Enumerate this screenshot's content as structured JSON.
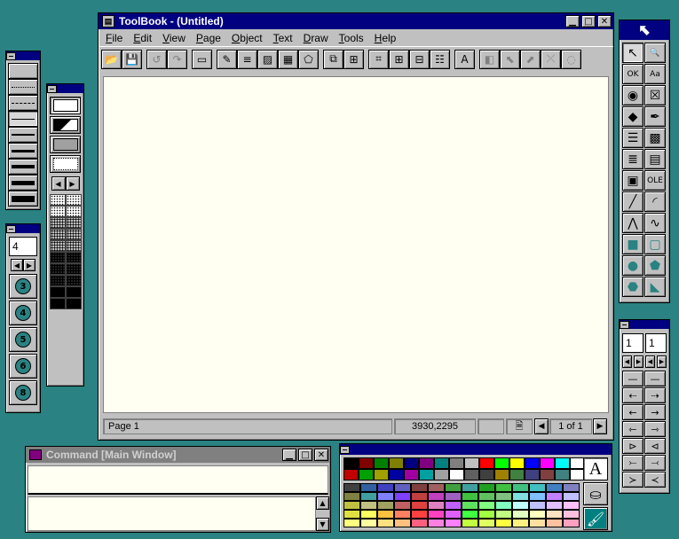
{
  "main_window": {
    "title": "ToolBook - (Untitled)",
    "menu": [
      "File",
      "Edit",
      "View",
      "Page",
      "Object",
      "Text",
      "Draw",
      "Tools",
      "Help"
    ],
    "toolbar": [
      {
        "icon": "open-folder-icon",
        "glyph": "📂"
      },
      {
        "icon": "save-disk-icon",
        "glyph": "💾"
      },
      {
        "icon": "undo-icon",
        "glyph": "↺",
        "disabled": true
      },
      {
        "icon": "redo-icon",
        "glyph": "↷",
        "disabled": true
      },
      {
        "icon": "field-icon",
        "glyph": "▭"
      },
      {
        "icon": "edit-properties-icon",
        "glyph": "✎"
      },
      {
        "icon": "line-list-icon",
        "glyph": "≡"
      },
      {
        "icon": "pattern-icon",
        "glyph": "▨"
      },
      {
        "icon": "palette-grid-icon",
        "glyph": "▦"
      },
      {
        "icon": "shapes-icon",
        "glyph": "⬠"
      },
      {
        "icon": "copy-page-icon",
        "glyph": "⧉"
      },
      {
        "icon": "new-page-icon",
        "glyph": "⊞"
      },
      {
        "icon": "camera-icon",
        "glyph": "⌗"
      },
      {
        "icon": "grid-icon",
        "glyph": "⊞"
      },
      {
        "icon": "button-tool-icon",
        "glyph": "⊟"
      },
      {
        "icon": "script-icon",
        "glyph": "☷"
      },
      {
        "icon": "text-font-icon",
        "glyph": "A"
      },
      {
        "icon": "align-left-icon",
        "glyph": "◧",
        "disabled": true
      },
      {
        "icon": "rotate-left-icon",
        "glyph": "⬉",
        "disabled": true
      },
      {
        "icon": "rotate-right-icon",
        "glyph": "⬈",
        "disabled": true
      },
      {
        "icon": "flip-icon",
        "glyph": "⤫",
        "disabled": true
      },
      {
        "icon": "reshape-icon",
        "glyph": "◌",
        "disabled": true
      }
    ],
    "status": {
      "page": "Page 1",
      "coords": "3930,2295",
      "page_of": "1 of 1"
    }
  },
  "command_window": {
    "title": "Command [Main Window]"
  },
  "line_palette": {
    "value": "4"
  },
  "polygon_sides": [
    "3",
    "4",
    "5",
    "6",
    "8"
  ],
  "spacing_palette": {
    "left_value": "1",
    "right_value": "1"
  },
  "tool_palette": [
    {
      "icon": "arrow-pointer-icon",
      "glyph": "↖"
    },
    {
      "icon": "magnifier-icon",
      "glyph": "🔍"
    },
    {
      "icon": "ok-button-tool-icon",
      "glyph": "OK"
    },
    {
      "icon": "text-label-tool-icon",
      "glyph": "Aa"
    },
    {
      "icon": "radio-button-tool-icon",
      "glyph": "◉"
    },
    {
      "icon": "checkbox-tool-icon",
      "glyph": "☒"
    },
    {
      "icon": "hotspot-tool-icon",
      "glyph": "◆"
    },
    {
      "icon": "pen-tool-icon",
      "glyph": "✒"
    },
    {
      "icon": "field-tool-icon",
      "glyph": "☰"
    },
    {
      "icon": "group-tool-icon",
      "glyph": "▩"
    },
    {
      "icon": "textbox-tool-icon",
      "glyph": "≣"
    },
    {
      "icon": "combobox-tool-icon",
      "glyph": "▤"
    },
    {
      "icon": "picture-tool-icon",
      "glyph": "▣"
    },
    {
      "icon": "ole-tool-icon",
      "glyph": "OLE"
    },
    {
      "icon": "line-tool-icon",
      "glyph": "╱"
    },
    {
      "icon": "arc-tool-icon",
      "glyph": "◜"
    },
    {
      "icon": "polyline-tool-icon",
      "glyph": "⋀"
    },
    {
      "icon": "curve-tool-icon",
      "glyph": "∿"
    },
    {
      "icon": "rectangle-tool-icon",
      "glyph": "■"
    },
    {
      "icon": "rounded-rectangle-tool-icon",
      "glyph": "▢"
    },
    {
      "icon": "ellipse-tool-icon",
      "glyph": "●"
    },
    {
      "icon": "polygon-tool-icon",
      "glyph": "⬟"
    },
    {
      "icon": "irregular-polygon-tool-icon",
      "glyph": "⬣"
    },
    {
      "icon": "pie-tool-icon",
      "glyph": "◣"
    }
  ],
  "colors": {
    "row1": [
      "#000000",
      "#800000",
      "#008000",
      "#808000",
      "#000080",
      "#800080",
      "#008080",
      "#808080",
      "#c0c0c0",
      "#ff0000",
      "#00ff00",
      "#ffff00",
      "#0000ff",
      "#ff00ff",
      "#00ffff",
      "#ffffff"
    ],
    "row2": [
      "#c00000",
      "#00a000",
      "#a0a000",
      "#0000a0",
      "#a000a0",
      "#00a0a0",
      "#a0a0a0",
      "#ffffff",
      "#606060",
      "#404040",
      "#a08000",
      "#408040",
      "#404080",
      "#804040",
      "#408080",
      "#ffffff"
    ],
    "grid": [
      [
        "#404040",
        "#3060a0",
        "#4040c0",
        "#6060c0",
        "#804040",
        "#a06060",
        "#40a040",
        "#40a0a0",
        "#20a020",
        "#40c040",
        "#40c080",
        "#40c0c0",
        "#4080c0",
        "#8080c0"
      ],
      [
        "#808040",
        "#40a0a0",
        "#8080ff",
        "#8040ff",
        "#c04040",
        "#c040c0",
        "#a060c0",
        "#40c040",
        "#60c060",
        "#80c080",
        "#80e0e0",
        "#80c0ff",
        "#c080ff",
        "#c0c0ff"
      ],
      [
        "#c0c040",
        "#c0c080",
        "#a0a060",
        "#c06060",
        "#e04040",
        "#e080c0",
        "#c060ff",
        "#60e060",
        "#80ff80",
        "#80ffc0",
        "#c0ffff",
        "#c0c0ff",
        "#e0c0ff",
        "#ffc0ff"
      ],
      [
        "#e0e040",
        "#ffff60",
        "#ffc040",
        "#ff8060",
        "#ff4040",
        "#ff40c0",
        "#e060ff",
        "#40ff40",
        "#a0ff40",
        "#c0ff80",
        "#e0ffc0",
        "#ffffc0",
        "#ffe0c0",
        "#ffc0e0"
      ],
      [
        "#ffff80",
        "#ffffa0",
        "#ffe080",
        "#ffc080",
        "#ff6080",
        "#ff80e0",
        "#ff80ff",
        "#c0ff40",
        "#e0ff60",
        "#ffff40",
        "#fff080",
        "#ffe0a0",
        "#ffc0a0",
        "#ffa0c0"
      ]
    ]
  }
}
